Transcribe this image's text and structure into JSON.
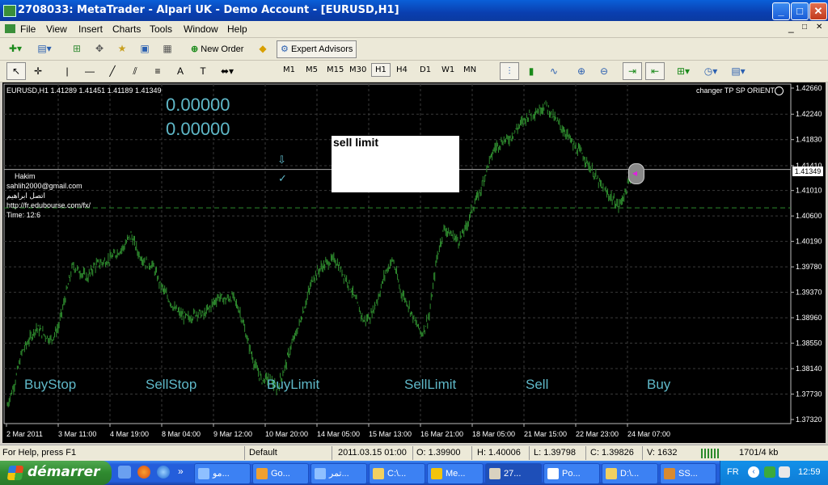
{
  "window": {
    "title": "2708033: MetaTrader - Alpari UK - Demo Account - [EURUSD,H1]",
    "minimize": "_",
    "maximize": "□",
    "close": "✕"
  },
  "menu": {
    "items": [
      "File",
      "View",
      "Insert",
      "Charts",
      "Tools",
      "Window",
      "Help"
    ],
    "controls": [
      "_",
      "□",
      "✕"
    ]
  },
  "toolbar": {
    "new_order": "New Order",
    "expert_advisors": "Expert Advisors",
    "timeframes": [
      "M1",
      "M5",
      "M15",
      "M30",
      "H1",
      "H4",
      "D1",
      "W1",
      "MN"
    ],
    "active_timeframe": "H1"
  },
  "chart": {
    "symbol_header": "EURUSD,H1  1.41289 1.41451 1.41189 1.41349",
    "indicator_name": "changer TP SP ORIENT",
    "value1": "0.00000",
    "value2": "0.00000",
    "sell_box_label": "sell limit",
    "info_lines": [
      "Hakim",
      "sahlih2000@gmail.com",
      "اتصل ابراهيم",
      "http://fr.edubourse.com/fx/",
      "Time: 12:6"
    ],
    "current_price": "1.41349",
    "order_labels": [
      "BuyStop",
      "SellStop",
      "BuyLimit",
      "SellLimit",
      "Sell",
      "Buy"
    ],
    "colors": {
      "background": "#000000",
      "bars": "#2e8b2e",
      "text": "#5fb8c8",
      "grid": "#3a3a3a"
    }
  },
  "chart_data": {
    "type": "line",
    "title": "",
    "x_tick_labels": [
      "2 Mar 2011",
      "3 Mar 11:00",
      "4 Mar 19:00",
      "8 Mar 04:00",
      "9 Mar 12:00",
      "10 Mar 20:00",
      "14 Mar 05:00",
      "15 Mar 13:00",
      "16 Mar 21:00",
      "18 Mar 05:00",
      "21 Mar 15:00",
      "22 Mar 23:00",
      "24 Mar 07:00"
    ],
    "y_tick_labels": [
      "1.42660",
      "1.42240",
      "1.41830",
      "1.41410",
      "1.41010",
      "1.40600",
      "1.40190",
      "1.39780",
      "1.39370",
      "1.38960",
      "1.38550",
      "1.38140",
      "1.37730",
      "1.37320"
    ],
    "ylim": [
      1.3732,
      1.4266
    ],
    "grid": true,
    "series": [
      {
        "values": [
          1.3755,
          1.379,
          1.384,
          1.386,
          1.388,
          1.387,
          1.386,
          1.388,
          1.393,
          1.398,
          1.397,
          1.396,
          1.398,
          1.3985,
          1.399,
          1.4,
          1.401,
          1.403,
          1.4,
          1.3985,
          1.398,
          1.395,
          1.393,
          1.391,
          1.39,
          1.3895,
          1.3905,
          1.39,
          1.3915,
          1.393,
          1.3925,
          1.393,
          1.3905,
          1.386,
          1.382,
          1.3795,
          1.38,
          1.378,
          1.381,
          1.385,
          1.388,
          1.392,
          1.396,
          1.3975,
          1.3985,
          1.399,
          1.397,
          1.395,
          1.392,
          1.389,
          1.39,
          1.393,
          1.397,
          1.399,
          1.394,
          1.392,
          1.389,
          1.387,
          1.39,
          1.399,
          1.404,
          1.403,
          1.402,
          1.404,
          1.4075,
          1.41,
          1.414,
          1.417,
          1.418,
          1.4185,
          1.42,
          1.4215,
          1.4225,
          1.423,
          1.424,
          1.422,
          1.4205,
          1.419,
          1.417,
          1.416,
          1.414,
          1.412,
          1.41,
          1.409,
          1.4075,
          1.41,
          1.413
        ]
      }
    ]
  },
  "status": {
    "help": "For Help, press F1",
    "profile": "Default",
    "datetime": "2011.03.15 01:00",
    "open": "O: 1.39900",
    "high": "H: 1.40006",
    "low": "L: 1.39798",
    "close": "C: 1.39826",
    "volume": "V: 1632",
    "traffic": "1701/4 kb"
  },
  "taskbar": {
    "start": "démarrer",
    "items": [
      "ﻣﻮ...",
      "Go...",
      "ﺗﻤﺮ...",
      "C:\\...",
      "Me...",
      "27...",
      "Po...",
      "D:\\...",
      "SS..."
    ],
    "active_index": 5,
    "language": "FR",
    "clock": "12:59"
  }
}
